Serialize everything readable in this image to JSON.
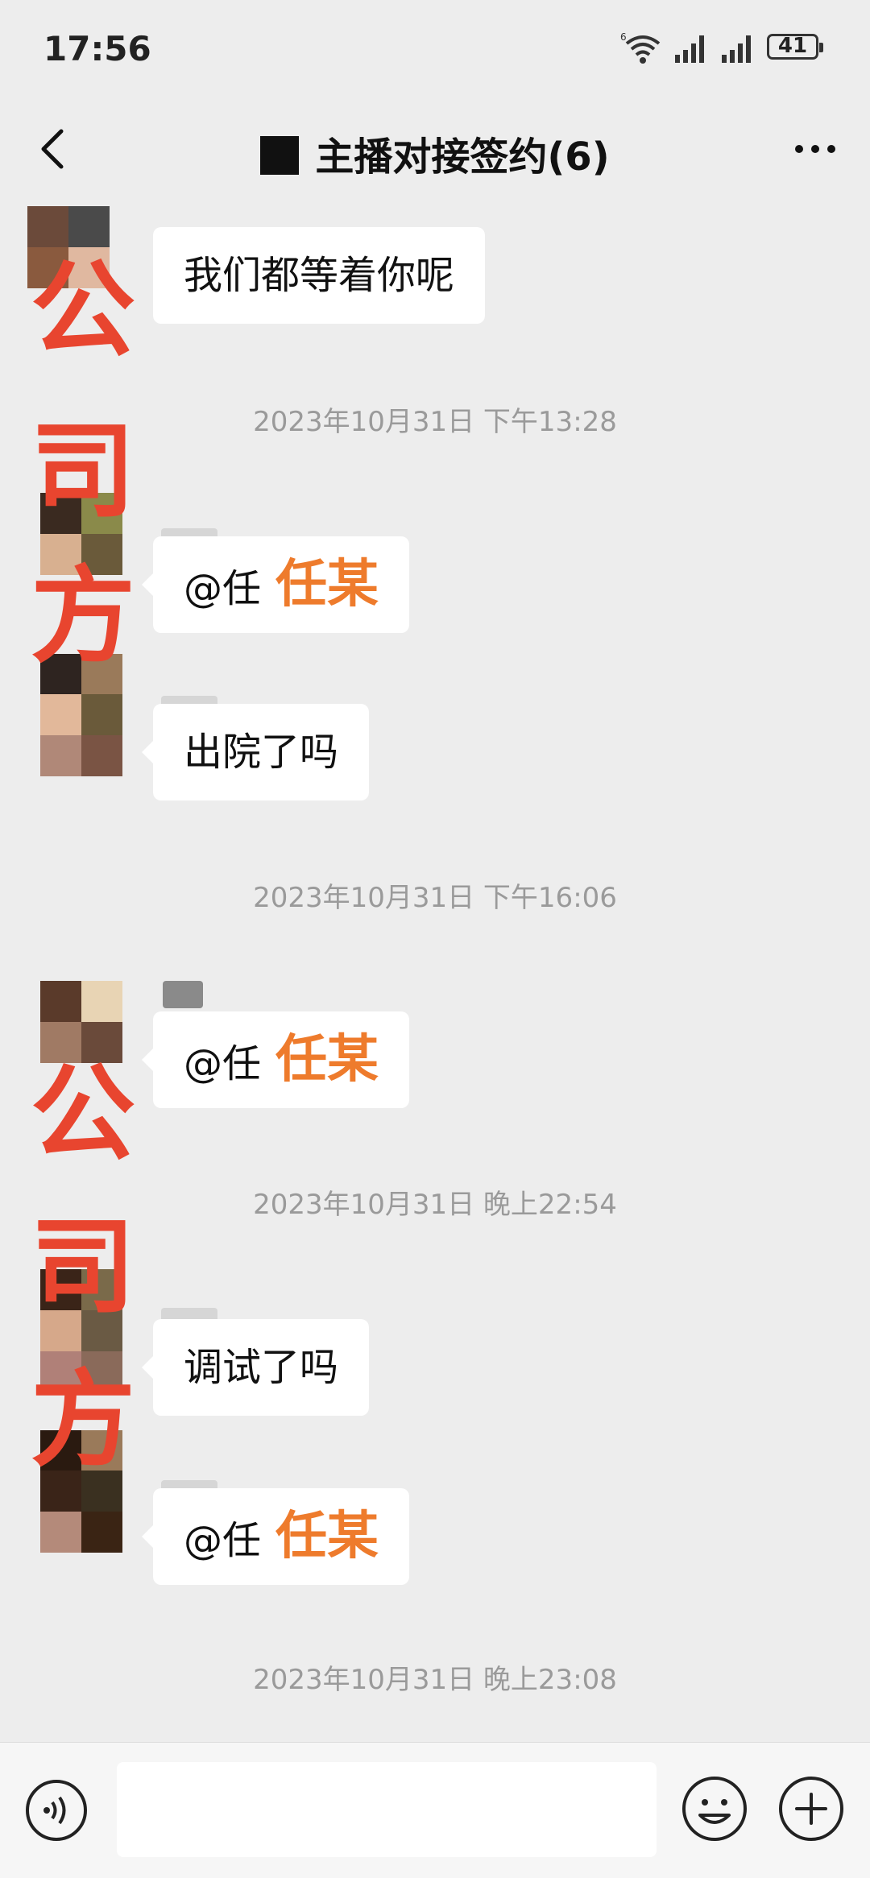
{
  "status_bar": {
    "time": "17:56",
    "battery_level": "41",
    "icons": [
      "wifi-icon",
      "signal-icon",
      "signal-icon",
      "battery-icon"
    ]
  },
  "header": {
    "title": "主播对接签约(6)",
    "back_icon": "chevron-left-icon",
    "more_icon": "more-horizontal-icon"
  },
  "overlay_labels": {
    "group1": [
      "公",
      "司",
      "方"
    ],
    "group2": [
      "公",
      "司",
      "方"
    ]
  },
  "messages": [
    {
      "text": "我们都等着你呢"
    },
    {
      "timestamp": "2023年10月31日 下午13:28"
    },
    {
      "text": "@任",
      "redaction": "任某"
    },
    {
      "text": "出院了吗"
    },
    {
      "timestamp": "2023年10月31日 下午16:06"
    },
    {
      "text": "@任",
      "redaction": "任某"
    },
    {
      "timestamp": "2023年10月31日 晚上22:54"
    },
    {
      "text": "调试了吗"
    },
    {
      "text": "@任",
      "redaction": "任某"
    },
    {
      "timestamp": "2023年10月31日 晚上23:08"
    }
  ],
  "input_bar": {
    "placeholder": "",
    "voice_icon": "voice-icon",
    "emoji_icon": "emoji-icon",
    "plus_icon": "plus-icon"
  },
  "colors": {
    "background": "#ededed",
    "bubble": "#ffffff",
    "overlay_red": "#e8452f",
    "redaction_orange": "#ee7b2c",
    "timestamp": "#9a9a9a"
  }
}
